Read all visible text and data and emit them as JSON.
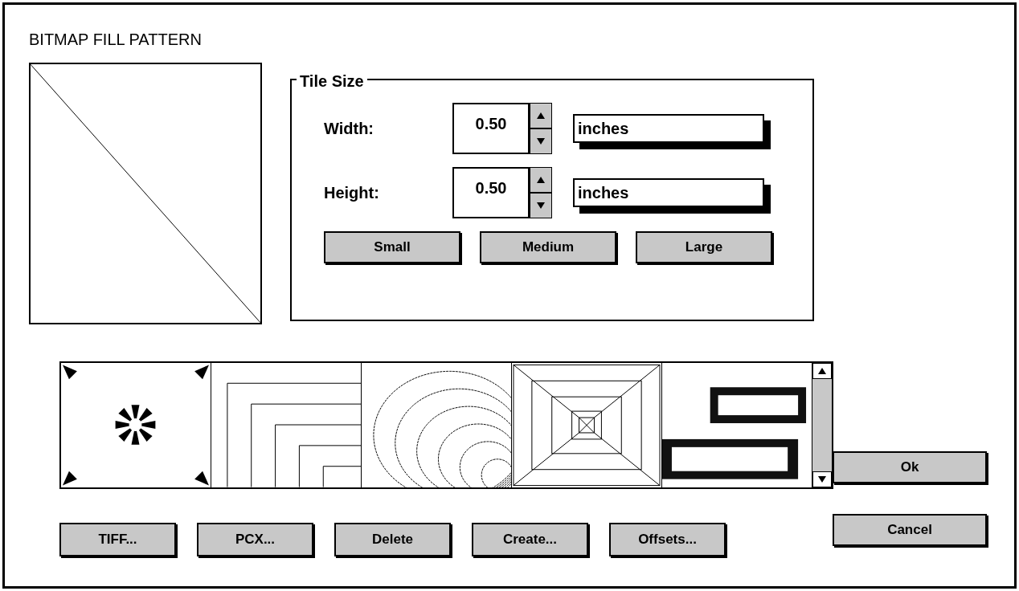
{
  "dialog": {
    "title": "BITMAP FILL PATTERN"
  },
  "tile_size": {
    "label": "Tile Size",
    "fields": [
      {
        "label": "Width:",
        "value": "0.50",
        "units": "inches"
      },
      {
        "label": "Height:",
        "value": "0.50",
        "units": "inches"
      }
    ],
    "buttons": [
      "Small",
      "Medium",
      "Large"
    ]
  },
  "patterns": [
    {
      "kind": "star"
    },
    {
      "kind": "steps"
    },
    {
      "kind": "rings"
    },
    {
      "kind": "pyramid"
    },
    {
      "kind": "picture"
    }
  ],
  "buttons": [
    "TIFF...",
    "PCX...",
    "Delete",
    "Create...",
    "Offsets..."
  ],
  "side_buttons": [
    "Ok",
    "Cancel"
  ]
}
